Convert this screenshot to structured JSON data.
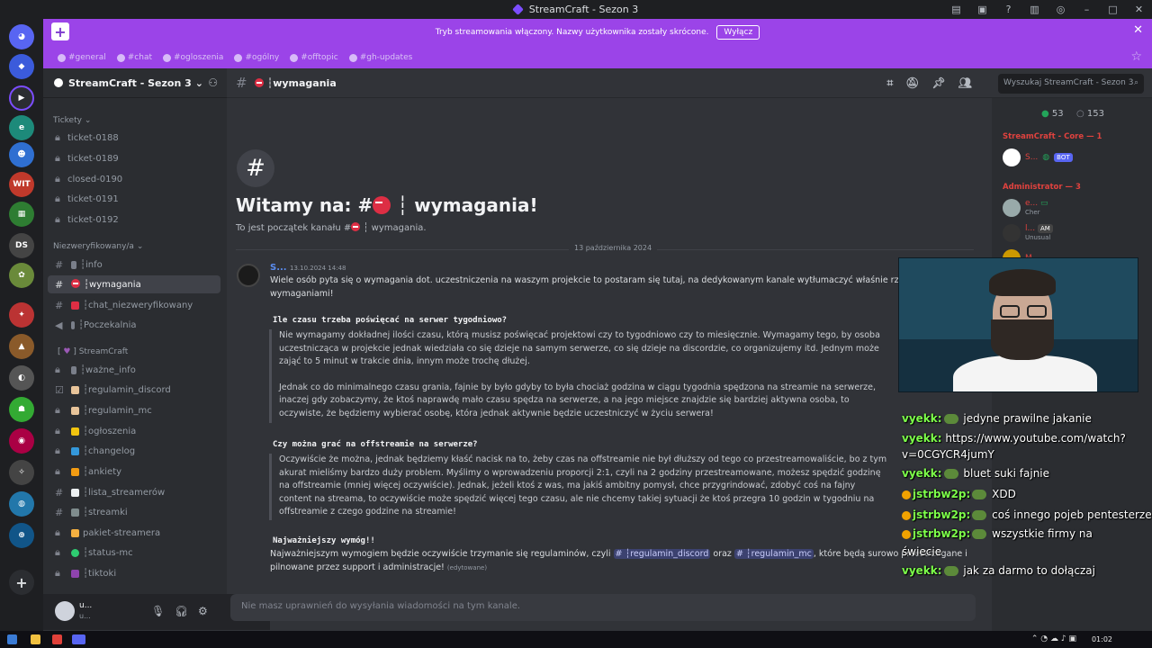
{
  "window": {
    "title": "StreamCraft - Sezon 3"
  },
  "banner": {
    "message": "Tryb streamowania włączony. Nazwy użytkownika zostały skrócone.",
    "button": "Wyłącz",
    "quick_channels": [
      "#general",
      "#chat",
      "#ogloszenia",
      "#ogólny",
      "#offtopic",
      "#gh-updates"
    ]
  },
  "server": {
    "name": "StreamCraft - Sezon 3"
  },
  "sidebar": {
    "cat_tickety": "Tickety",
    "tickets": [
      "ticket-0188",
      "ticket-0189",
      "closed-0190",
      "ticket-0191",
      "ticket-0192"
    ],
    "cat_niezw": "Niezweryfikowany/a",
    "niezw": [
      "┆info",
      "┆wymagania",
      "┆chat_niezweryfikowany",
      "┆Poczekalnia"
    ],
    "cat_streamcraft": "StreamCraft",
    "streamcraft": [
      "┆ważne_info",
      "┆regulamin_discord",
      "┆regulamin_mc",
      "┆ogłoszenia",
      "┆changelog",
      "┆ankiety",
      "┆lista_streamerów",
      "┆streamki",
      "pakiet-streamera",
      "┆status-mc",
      "┆tiktoki"
    ]
  },
  "user": {
    "name": "u...",
    "status": "u..."
  },
  "channel": {
    "name": "┆wymagania",
    "search_placeholder": "Wyszukaj StreamCraft - Sezon 3"
  },
  "welcome": {
    "title_prefix": "Witamy na: #",
    "title_suffix": " ┆ wymagania!",
    "sub_prefix": "To jest początek kanału #",
    "sub_suffix": " ┆ wymagania."
  },
  "divider_date": "13 października 2024",
  "message": {
    "author": "S...",
    "time": "13.10.2024 14:48",
    "intro": "Wiele osób pyta się o wymagania dot. uczestniczenia na waszym projekcie to postaram się tutaj, na dedykowanym kanale wytłumaczyć właśnie rzeczy zwią",
    "intro2": "wymaganiami!",
    "q1": "Ile czasu trzeba poświęcać na serwer tygodniowo?",
    "a1": "Nie wymagamy dokładnej ilości czasu, którą musisz poświęcać projektowi czy to tygodniowo czy to miesięcznie. Wymagamy tego, by osoba uczestnicząca w projekcie jednak wiedziała co się dzieje na samym serwerze, co się dzieje na discordzie, co organizujemy itd. Jednym może zająć to 5 minut w trakcie dnia, innym może trochę dłużej.",
    "a1b": "Jednak co do minimalnego czasu grania, fajnie by było gdyby to była chociaż godzina w ciągu tygodnia spędzona na streamie na serwerze, inaczej gdy zobaczymy, że ktoś naprawdę mało czasu spędza na serwerze, a na jego miejsce znajdzie się bardziej aktywna osoba, to oczywiste, że będziemy wybierać osobę, która jednak aktywnie będzie uczestniczyć w życiu serwera!",
    "q2": "Czy można grać na offstreamie na serwerze?",
    "a2": "Oczywiście że można, jednak będziemy kłaść nacisk na to, żeby czas na offstreamie nie był dłuższy od tego co przestreamowaliście, bo z tym akurat mieliśmy bardzo duży problem. Myślimy o wprowadzeniu proporcji 2:1, czyli na 2 godziny przestreamowane, możesz spędzić godzinę na offstreamie (mniej więcej oczywiście). Jednak, jeżeli ktoś z was, ma jakiś ambitny pomysł, chce przygrindować, zdobyć coś na fajny content na streama, to oczywiście może spędzić więcej tego czasu, ale nie chcemy takiej sytuacji że ktoś przegra 10 godzin w tygodniu na offstreamie z czego godzine na streamie!",
    "q3": "Najważniejszy wymóg!!",
    "a3_pre": "Najważniejszym wymogiem będzie oczywiście trzymanie się regulaminów, czyli ",
    "m1": "# ┆regulamin_discord",
    "a3_mid": " oraz ",
    "m2": "# ┆regulamin_mc",
    "a3_post": ", które będą surowo przestrzegane i",
    "a3_end": "pilnowane przez support i administracje!",
    "edited": "(edytowane)"
  },
  "composer": {
    "placeholder": "Nie masz uprawnień do wysyłania wiadomości na tym kanale."
  },
  "members": {
    "online": "53",
    "offline": "153",
    "role1": "StreamCraft - Core — 1",
    "m1": "S...",
    "m1badge": "BOT",
    "role2": "Administrator — 3",
    "m2": "e...",
    "m2sub": "Cher",
    "m3": "l...",
    "m3tag": "AM",
    "m3sub": "Unusual",
    "m4": "M..."
  },
  "twitch_chat": [
    {
      "user": "vyekk:",
      "text": " jedyne prawilne jakanie"
    },
    {
      "user": "vyekk:",
      "text": " https://www.youtube.com/watch?"
    },
    {
      "user": "",
      "text": "v=0CGYCR4jumY"
    },
    {
      "user": "vyekk:",
      "text": " bluet suki fajnie"
    },
    {
      "user": "jstrbw2p:",
      "text": " XDD"
    },
    {
      "user": "jstrbw2p:",
      "text": " coś innego pojeb pentesterze"
    },
    {
      "user": "jstrbw2p:",
      "text": " wszystkie firmy na"
    },
    {
      "user": "",
      "text": "świecie"
    },
    {
      "user": "vyekk:",
      "text": " jak za darmo to dołączaj"
    }
  ],
  "taskbar": {
    "time": "01:02"
  }
}
